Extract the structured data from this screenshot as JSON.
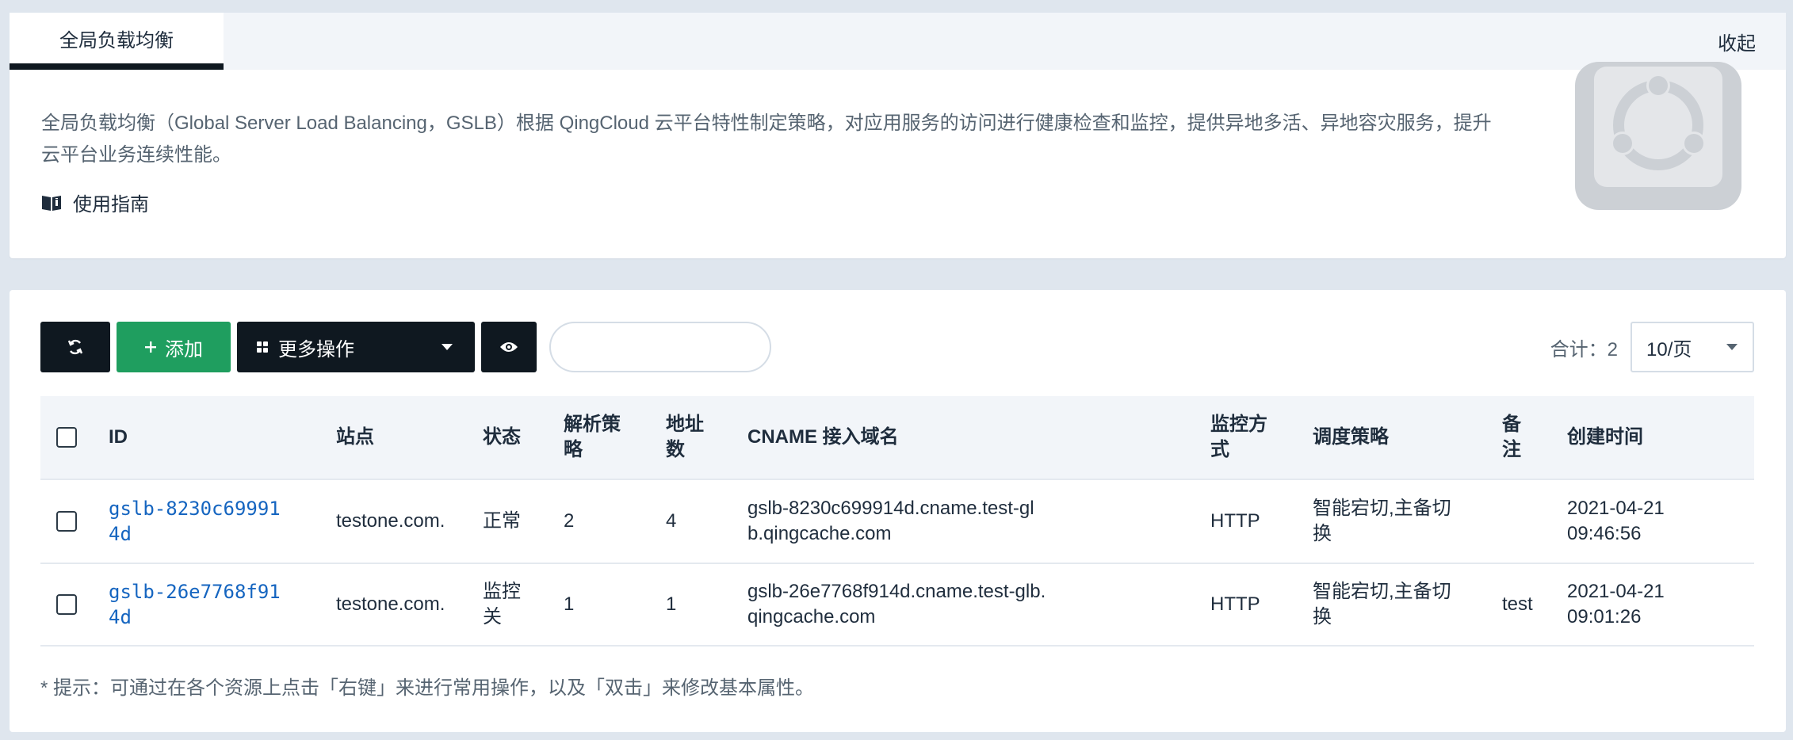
{
  "tabs": {
    "active": "全局负载均衡",
    "collapse": "收起"
  },
  "intro": {
    "description": "全局负载均衡（Global Server Load Balancing，GSLB）根据 QingCloud 云平台特性制定策略，对应用服务的访问进行健康检查和监控，提供异地多活、异地容灾服务，提升云平台业务连续性能。",
    "guide_label": "使用指南"
  },
  "toolbar": {
    "add_label": "添加",
    "more_label": "更多操作",
    "search_value": ""
  },
  "pagination": {
    "total_text": "合计：2",
    "page_size": "10/页"
  },
  "table": {
    "headers": {
      "id": "ID",
      "site": "站点",
      "status": "状态",
      "policy": "解析策略",
      "addr_count": "地址数",
      "cname": "CNAME 接入域名",
      "monitor": "监控方式",
      "dispatch": "调度策略",
      "note": "备注",
      "created": "创建时间"
    },
    "rows": [
      {
        "id": "gslb-8230c699914d",
        "site": "testone.com.",
        "status": "正常",
        "policy": "2",
        "addr_count": "4",
        "cname": "gslb-8230c699914d.cname.test-glb.qingcache.com",
        "monitor": "HTTP",
        "dispatch": "智能宕切,主备切换",
        "note": "",
        "created": "2021-04-21 09:46:56"
      },
      {
        "id": "gslb-26e7768f914d",
        "site": "testone.com.",
        "status": "监控关",
        "policy": "1",
        "addr_count": "1",
        "cname": "gslb-26e7768f914d.cname.test-glb.qingcache.com",
        "monitor": "HTTP",
        "dispatch": "智能宕切,主备切换",
        "note": "test",
        "created": "2021-04-21 09:01:26"
      }
    ]
  },
  "hint": "* 提示：可通过在各个资源上点击「右键」来进行常用操作，以及「双击」来修改基本属性。",
  "colors": {
    "primary_dark": "#0f1820",
    "add_green": "#1f9e5f",
    "link_blue": "#1565c0",
    "page_bg": "#dfe6ee"
  },
  "icons": [
    "refresh-icon",
    "plus-icon",
    "grid-icon",
    "caret-down-icon",
    "eye-icon",
    "book-icon"
  ]
}
